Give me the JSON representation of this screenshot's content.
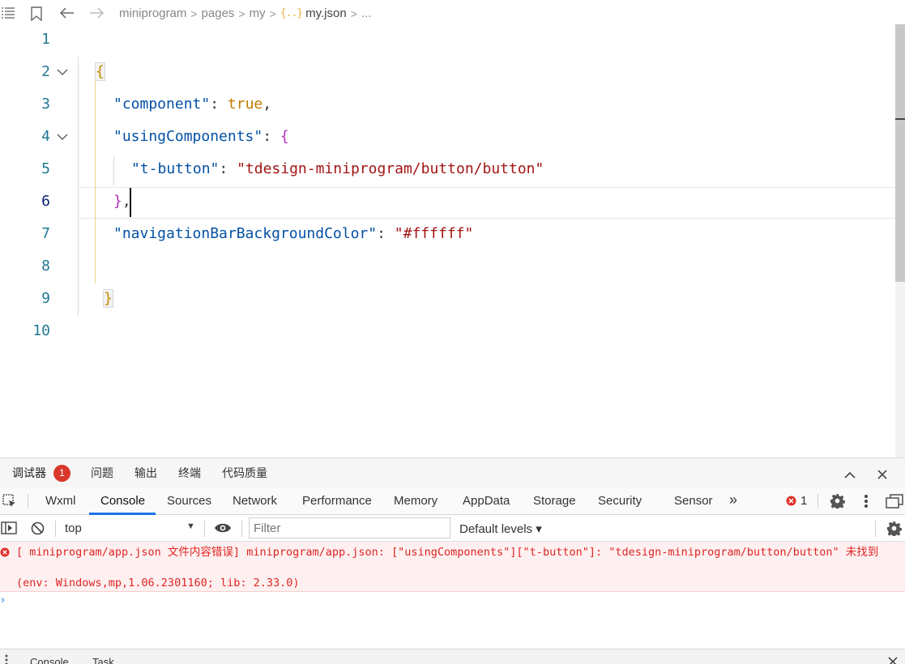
{
  "breadcrumb": {
    "items": [
      "miniprogram",
      "pages",
      "my"
    ],
    "file_icon": "{..}",
    "file": "my.json",
    "more": "..."
  },
  "editor": {
    "line_numbers": [
      "1",
      "2",
      "3",
      "4",
      "5",
      "6",
      "7",
      "8",
      "9",
      "10"
    ],
    "active_line": 6,
    "lines": {
      "l2_open": "{",
      "l3_key": "\"component\"",
      "l3_colon": ": ",
      "l3_val": "true",
      "l3_comma": ",",
      "l4_key": "\"usingComponents\"",
      "l4_colon": ": ",
      "l4_brace": "{",
      "l5_key": "\"t-button\"",
      "l5_colon": ": ",
      "l5_val": "\"tdesign-miniprogram/button/button\"",
      "l6_brace": "}",
      "l6_comma": ",",
      "l7_key": "\"navigationBarBackgroundColor\"",
      "l7_colon": ": ",
      "l7_val": "\"#ffffff\"",
      "l9_close": "}"
    }
  },
  "panel": {
    "tabs": [
      "调试器",
      "问题",
      "输出",
      "终端",
      "代码质量"
    ],
    "debugger_badge": "1",
    "devtools_tabs": [
      "Wxml",
      "Console",
      "Sources",
      "Network",
      "Performance",
      "Memory",
      "AppData",
      "Storage",
      "Security",
      "Sensor"
    ],
    "active_devtools_tab": "Console",
    "more_tabs": "»",
    "error_count": "1",
    "context": "top",
    "filter_placeholder": "Filter",
    "levels": "Default levels ▾",
    "error_message": "[ miniprogram/app.json 文件内容错误] miniprogram/app.json: [\"usingComponents\"][\"t-button\"]: \"tdesign-miniprogram/button/button\" 未找到",
    "error_env": "(env: Windows,mp,1.06.2301160; lib: 2.33.0)",
    "prompt": "›",
    "drawer_tabs": [
      "Console",
      "Task"
    ]
  },
  "colors": {
    "line_number": "#237893",
    "json_key": "#0451a5",
    "json_string": "#a31515",
    "error_text": "#e02424",
    "error_bg": "#fef0f0",
    "active_tab_underline": "#1a73e8",
    "badge": "#d9372c"
  },
  "icons": [
    "list-icon",
    "bookmark-icon",
    "back-arrow-icon",
    "forward-arrow-icon",
    "chevron-up-icon",
    "close-icon",
    "inspect-icon",
    "device-icon",
    "error-icon",
    "gear-icon",
    "kebab-menu-icon",
    "dock-icon",
    "sidebar-toggle-icon",
    "clear-console-icon",
    "eye-icon",
    "prompt-chevron-icon"
  ]
}
